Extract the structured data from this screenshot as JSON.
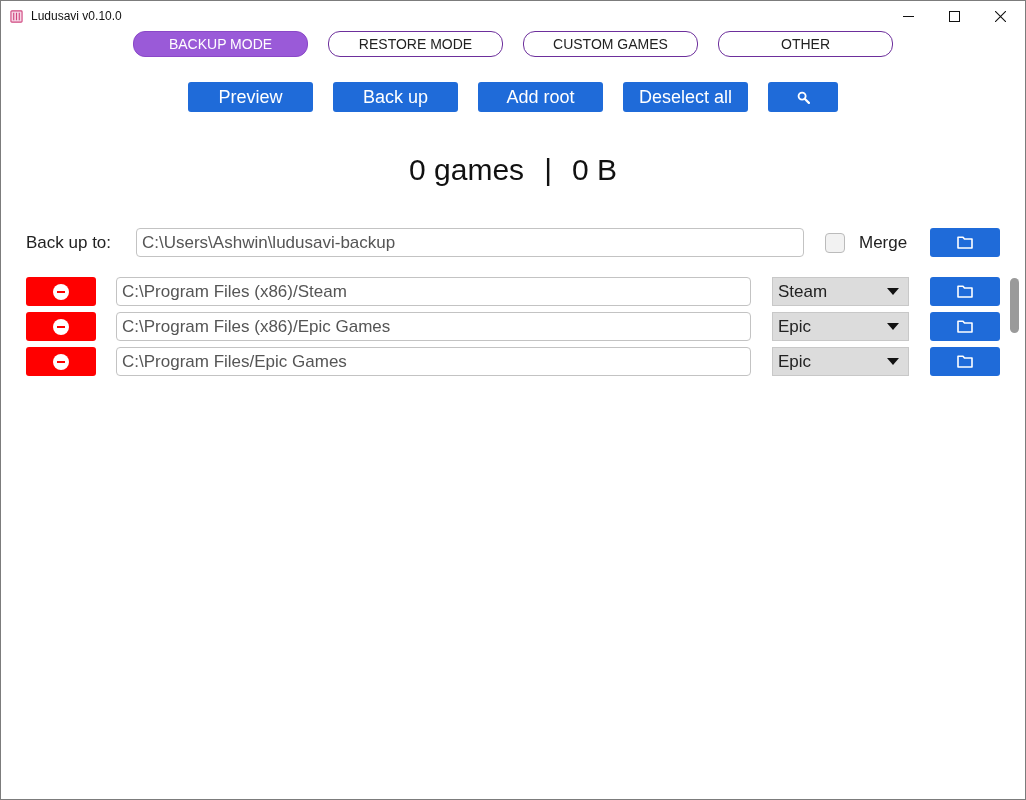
{
  "window": {
    "title": "Ludusavi v0.10.0"
  },
  "modes": [
    {
      "label": "BACKUP MODE",
      "selected": true
    },
    {
      "label": "RESTORE MODE",
      "selected": false
    },
    {
      "label": "CUSTOM GAMES",
      "selected": false
    },
    {
      "label": "OTHER",
      "selected": false
    }
  ],
  "actions": [
    {
      "kind": "text",
      "label": "Preview"
    },
    {
      "kind": "text",
      "label": "Back up"
    },
    {
      "kind": "text",
      "label": "Add root"
    },
    {
      "kind": "text",
      "label": "Deselect all"
    },
    {
      "kind": "search"
    }
  ],
  "summary": {
    "games": "0 games",
    "separator": "|",
    "size": "0 B"
  },
  "backup_target": {
    "label": "Back up to:",
    "value": "C:\\Users\\Ashwin\\ludusavi-backup",
    "merge": {
      "label": "Merge",
      "checked": false
    }
  },
  "roots": [
    {
      "path": "C:\\Program Files (x86)/Steam",
      "store": "Steam"
    },
    {
      "path": "C:\\Program Files (x86)/Epic Games",
      "store": "Epic"
    },
    {
      "path": "C:\\Program Files/Epic Games",
      "store": "Epic"
    }
  ]
}
